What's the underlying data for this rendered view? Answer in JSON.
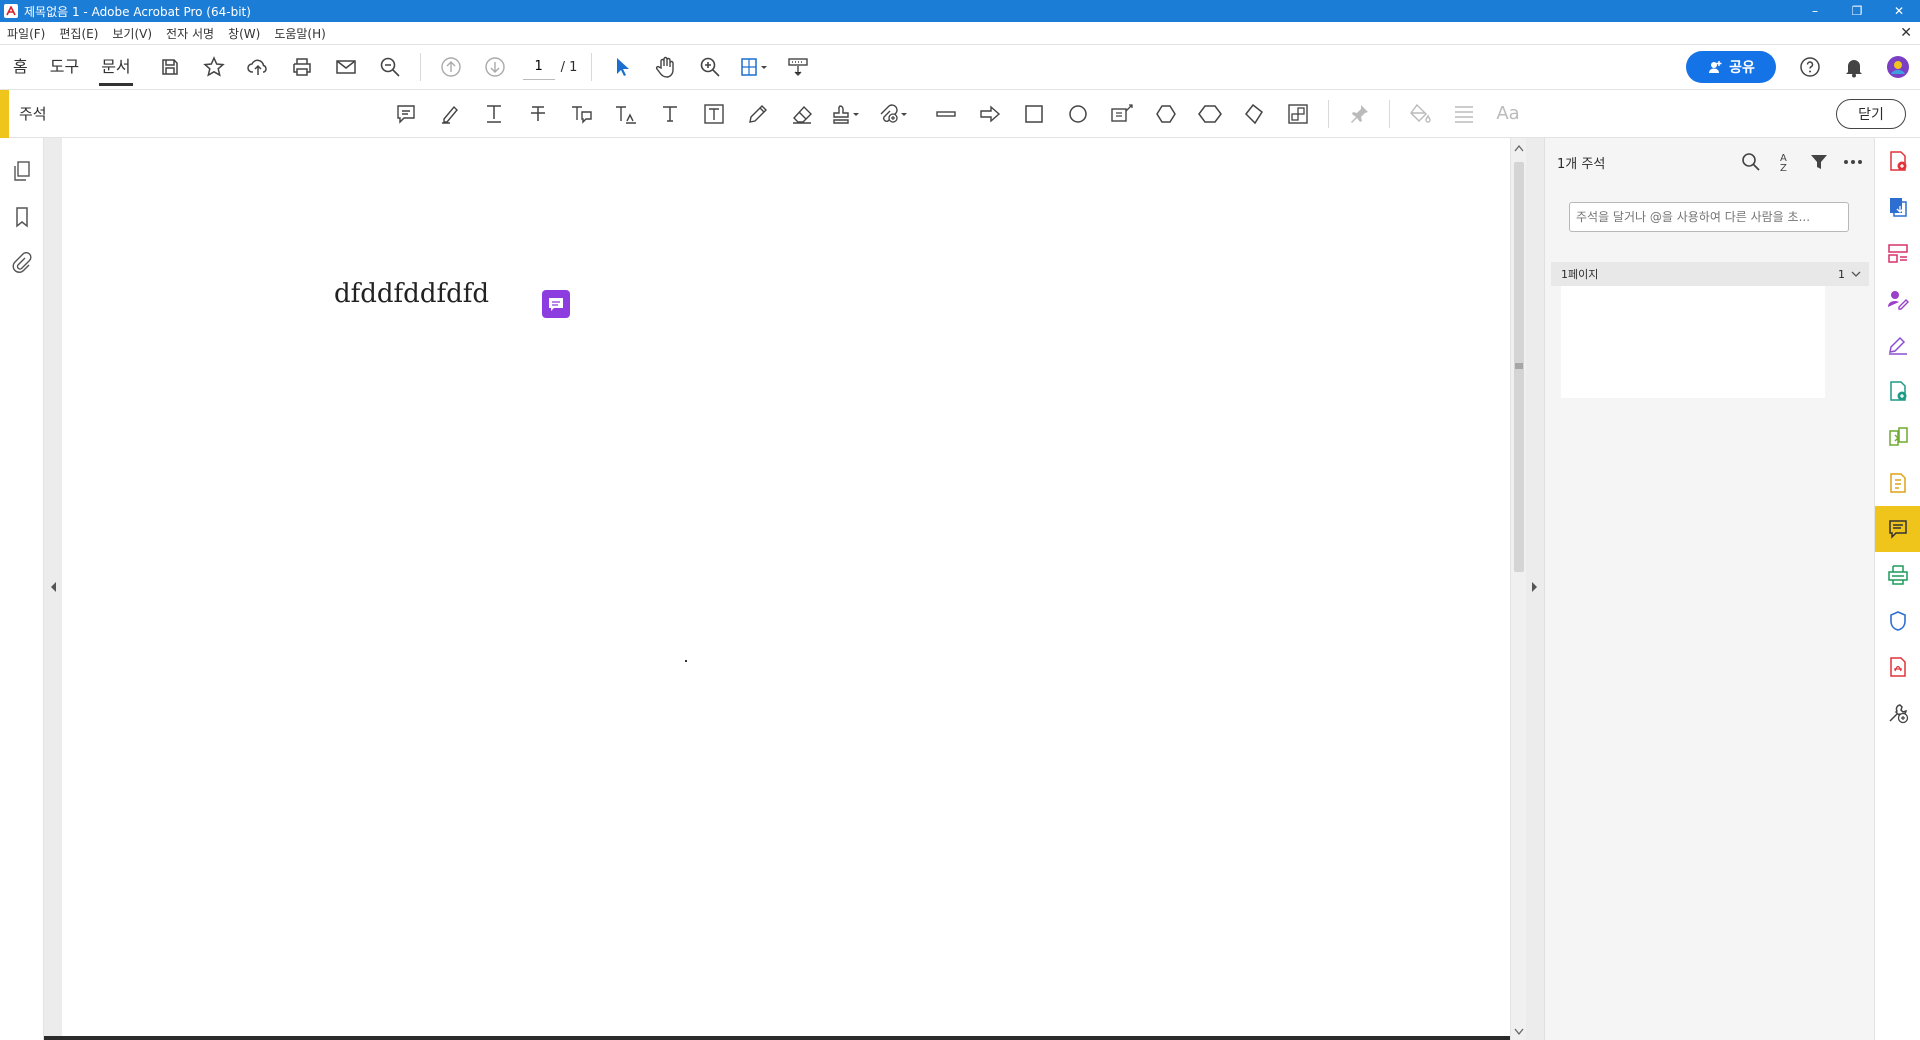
{
  "window": {
    "title": "제목없음 1 - Adobe Acrobat Pro (64-bit)",
    "minimize": "–",
    "restore": "❐",
    "close": "✕"
  },
  "menu": {
    "items": [
      "파일(F)",
      "편집(E)",
      "보기(V)",
      "전자 서명",
      "창(W)",
      "도움말(H)"
    ],
    "close": "✕"
  },
  "toolbar": {
    "tabs": [
      "홈",
      "도구",
      "문서"
    ],
    "active_tab": "문서",
    "page_current": "1",
    "page_total": "/ 1",
    "share_label": "공유",
    "share_color": "#1473e6"
  },
  "comment_toolbar": {
    "label": "주석",
    "close_label": "닫기",
    "accent_color": "#f0c51b",
    "font_tool_label": "Aa"
  },
  "document": {
    "text": "dfddfddfdfd",
    "note_color": "#8d3ce0"
  },
  "comments_panel": {
    "title": "1개 주석",
    "sort_glyph_top": "A",
    "sort_glyph_bottom": "Z",
    "input_placeholder": "주석을 달거나 @을 사용하여 다른 사람을 초...",
    "page_group_label": "1페이지",
    "page_group_count": "1"
  }
}
